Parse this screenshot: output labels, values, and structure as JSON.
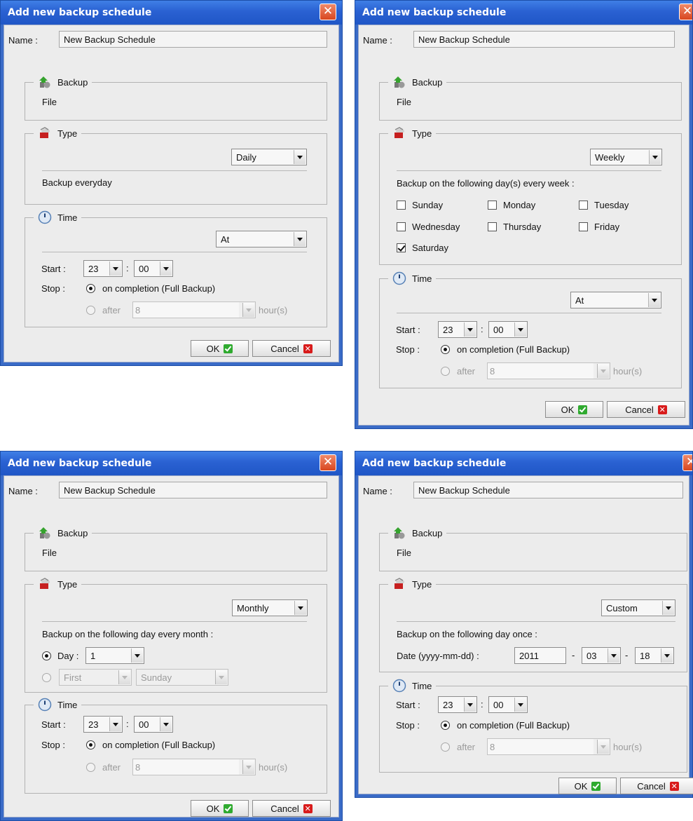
{
  "dialogs": [
    {
      "title": "Add new backup schedule",
      "close_glyph": "✕",
      "name_label": "Name :",
      "name_value": "New Backup Schedule",
      "backup_legend": "Backup",
      "backup_value": "File",
      "type_legend": "Type",
      "type_selected": "Daily",
      "type_description": "Backup everyday",
      "time_legend": "Time",
      "time_mode": "At",
      "start_label": "Start :",
      "start_hour": "23",
      "time_colon": ":",
      "start_minute": "00",
      "stop_label": "Stop :",
      "stop_completion_label": "on completion (Full Backup)",
      "stop_after_label": "after",
      "stop_after_value": "8",
      "hours_label": "hour(s)",
      "ok_label": "OK",
      "cancel_label": "Cancel"
    },
    {
      "title": "Add new backup schedule",
      "close_glyph": "✕",
      "name_label": "Name :",
      "name_value": "New Backup Schedule",
      "backup_legend": "Backup",
      "backup_value": "File",
      "type_legend": "Type",
      "type_selected": "Weekly",
      "type_description": "Backup on the following day(s) every week :",
      "days": [
        {
          "label": "Sunday",
          "checked": false
        },
        {
          "label": "Monday",
          "checked": false
        },
        {
          "label": "Tuesday",
          "checked": false
        },
        {
          "label": "Wednesday",
          "checked": false
        },
        {
          "label": "Thursday",
          "checked": false
        },
        {
          "label": "Friday",
          "checked": false
        },
        {
          "label": "Saturday",
          "checked": true
        }
      ],
      "time_legend": "Time",
      "time_mode": "At",
      "start_label": "Start :",
      "start_hour": "23",
      "time_colon": ":",
      "start_minute": "00",
      "stop_label": "Stop :",
      "stop_completion_label": "on completion (Full Backup)",
      "stop_after_label": "after",
      "stop_after_value": "8",
      "hours_label": "hour(s)",
      "ok_label": "OK",
      "cancel_label": "Cancel"
    },
    {
      "title": "Add new backup schedule",
      "close_glyph": "✕",
      "name_label": "Name :",
      "name_value": "New Backup Schedule",
      "backup_legend": "Backup",
      "backup_value": "File",
      "type_legend": "Type",
      "type_selected": "Monthly",
      "type_description": "Backup on the following day every month :",
      "day_label": "Day :",
      "day_value": "1",
      "ordinal_value": "First",
      "weekday_value": "Sunday",
      "time_legend": "Time",
      "start_label": "Start :",
      "start_hour": "23",
      "time_colon": ":",
      "start_minute": "00",
      "stop_label": "Stop :",
      "stop_completion_label": "on completion (Full Backup)",
      "stop_after_label": "after",
      "stop_after_value": "8",
      "hours_label": "hour(s)",
      "ok_label": "OK",
      "cancel_label": "Cancel"
    },
    {
      "title": "Add new backup schedule",
      "close_glyph": "✕",
      "name_label": "Name :",
      "name_value": "New Backup Schedule",
      "backup_legend": "Backup",
      "backup_value": "File",
      "type_legend": "Type",
      "type_selected": "Custom",
      "type_description": "Backup on the following day once :",
      "date_label": "Date (yyyy-mm-dd) :",
      "date_year": "2011",
      "date_dash": "-",
      "date_month": "03",
      "date_day": "18",
      "time_legend": "Time",
      "start_label": "Start :",
      "start_hour": "23",
      "time_colon": ":",
      "start_minute": "00",
      "stop_label": "Stop :",
      "stop_completion_label": "on completion (Full Backup)",
      "stop_after_label": "after",
      "stop_after_value": "8",
      "hours_label": "hour(s)",
      "ok_label": "OK",
      "cancel_label": "Cancel"
    }
  ],
  "icons": {
    "backup": "backup-upload-icon",
    "type": "type-bucket-icon",
    "time": "clock-icon",
    "ok": "check-icon",
    "cancel": "x-icon"
  },
  "colors": {
    "titlebar": "#2a61d2",
    "client_bg": "#ececec",
    "close_button": "#d8461f",
    "ok_icon": "#2faa2f",
    "cancel_icon": "#d81b1b"
  }
}
